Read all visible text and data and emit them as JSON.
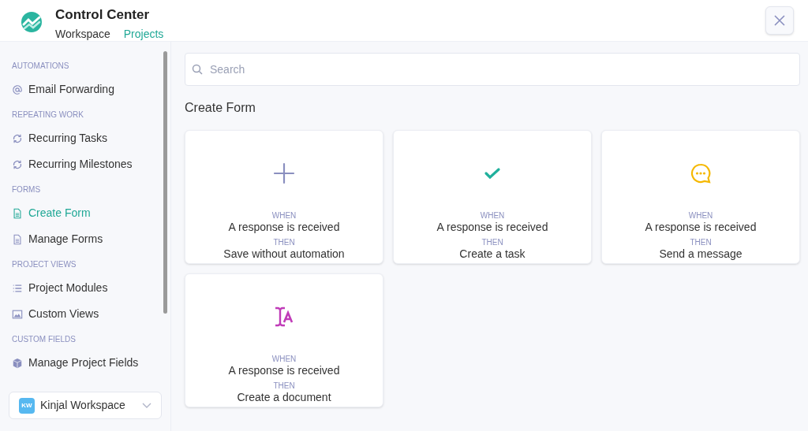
{
  "header": {
    "title": "Control Center",
    "tabs": [
      {
        "label": "Workspace",
        "selected": false
      },
      {
        "label": "Projects",
        "selected": true
      }
    ]
  },
  "sidebar": {
    "sections": [
      {
        "heading": "AUTOMATIONS",
        "items": [
          {
            "label": "Email Forwarding",
            "kind": "at",
            "selected": false
          }
        ]
      },
      {
        "heading": "REPEATING WORK",
        "items": [
          {
            "label": "Recurring Tasks",
            "kind": "repeat",
            "selected": false
          },
          {
            "label": "Recurring Milestones",
            "kind": "repeat",
            "selected": false
          }
        ]
      },
      {
        "heading": "FORMS",
        "items": [
          {
            "label": "Create Form",
            "kind": "form",
            "selected": true
          },
          {
            "label": "Manage Forms",
            "kind": "form",
            "selected": false
          }
        ]
      },
      {
        "heading": "PROJECT VIEWS",
        "items": [
          {
            "label": "Project Modules",
            "kind": "list",
            "selected": false
          },
          {
            "label": "Custom Views",
            "kind": "image",
            "selected": false
          }
        ]
      },
      {
        "heading": "CUSTOM FIELDS",
        "items": [
          {
            "label": "Manage Project Fields",
            "kind": "cube",
            "selected": false
          }
        ]
      }
    ],
    "workspace": {
      "badge": "KW",
      "name": "Kinjal Workspace"
    }
  },
  "search": {
    "placeholder": "Search"
  },
  "section_title": "Create Form",
  "cards": [
    {
      "kind": "plus",
      "when_label": "WHEN",
      "when": "A response is received",
      "then_label": "THEN",
      "then": "Save without automation"
    },
    {
      "kind": "check",
      "when_label": "WHEN",
      "when": "A response is received",
      "then_label": "THEN",
      "then": "Create a task"
    },
    {
      "kind": "message",
      "when_label": "WHEN",
      "when": "A response is received",
      "then_label": "THEN",
      "then": "Send a message"
    },
    {
      "kind": "document",
      "when_label": "WHEN",
      "when": "A response is received",
      "then_label": "THEN",
      "then": "Create a document"
    }
  ]
}
